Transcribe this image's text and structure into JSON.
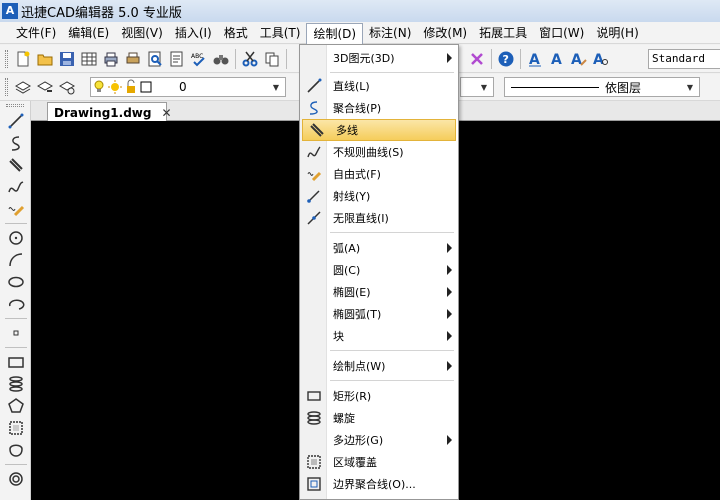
{
  "window": {
    "title": "迅捷CAD编辑器 5.0 专业版",
    "logo_text": "A"
  },
  "menubar": {
    "items": [
      {
        "label": "文件(F)"
      },
      {
        "label": "编辑(E)"
      },
      {
        "label": "视图(V)"
      },
      {
        "label": "插入(I)"
      },
      {
        "label": "格式"
      },
      {
        "label": "工具(T)"
      },
      {
        "label": "绘制(D)"
      },
      {
        "label": "标注(N)"
      },
      {
        "label": "修改(M)"
      },
      {
        "label": "拓展工具"
      },
      {
        "label": "窗口(W)"
      },
      {
        "label": "说明(H)"
      }
    ],
    "active_index": 6
  },
  "toolbar": {
    "text_style": "Standard",
    "layer_value": "0",
    "linetype_value": "依图层"
  },
  "tabs": {
    "document": "Drawing1.dwg",
    "close_glyph": "✕"
  },
  "draw_menu": {
    "items": [
      {
        "label": "3D图元(3D)",
        "submenu": true,
        "icon": "none"
      },
      {
        "label": "直线(L)",
        "submenu": false,
        "icon": "line-icon"
      },
      {
        "label": "聚合线(P)",
        "submenu": false,
        "icon": "polyline-icon"
      },
      {
        "label": "多线",
        "submenu": false,
        "icon": "multiline-icon",
        "highlighted": true
      },
      {
        "label": "不规则曲线(S)",
        "submenu": false,
        "icon": "spline-icon"
      },
      {
        "label": "自由式(F)",
        "submenu": false,
        "icon": "freehand-icon"
      },
      {
        "label": "射线(Y)",
        "submenu": false,
        "icon": "ray-icon"
      },
      {
        "label": "无限直线(I)",
        "submenu": false,
        "icon": "xline-icon"
      },
      {
        "label": "弧(A)",
        "submenu": true,
        "icon": "none"
      },
      {
        "label": "圆(C)",
        "submenu": true,
        "icon": "none"
      },
      {
        "label": "椭圆(E)",
        "submenu": true,
        "icon": "none"
      },
      {
        "label": "椭圆弧(T)",
        "submenu": true,
        "icon": "none"
      },
      {
        "label": "块",
        "submenu": true,
        "icon": "none"
      },
      {
        "label": "绘制点(W)",
        "submenu": true,
        "icon": "none"
      },
      {
        "label": "矩形(R)",
        "submenu": false,
        "icon": "rectangle-icon"
      },
      {
        "label": "螺旋",
        "submenu": false,
        "icon": "helix-icon"
      },
      {
        "label": "多边形(G)",
        "submenu": true,
        "icon": "none"
      },
      {
        "label": "区域覆盖",
        "submenu": false,
        "icon": "wipeout-icon"
      },
      {
        "label": "边界聚合线(O)...",
        "submenu": false,
        "icon": "boundary-icon"
      }
    ]
  },
  "colors": {
    "highlight_top": "#fbe6a8",
    "highlight_bottom": "#f5cd5b",
    "canvas": "#000000",
    "icon_blue": "#1d5fb8"
  }
}
